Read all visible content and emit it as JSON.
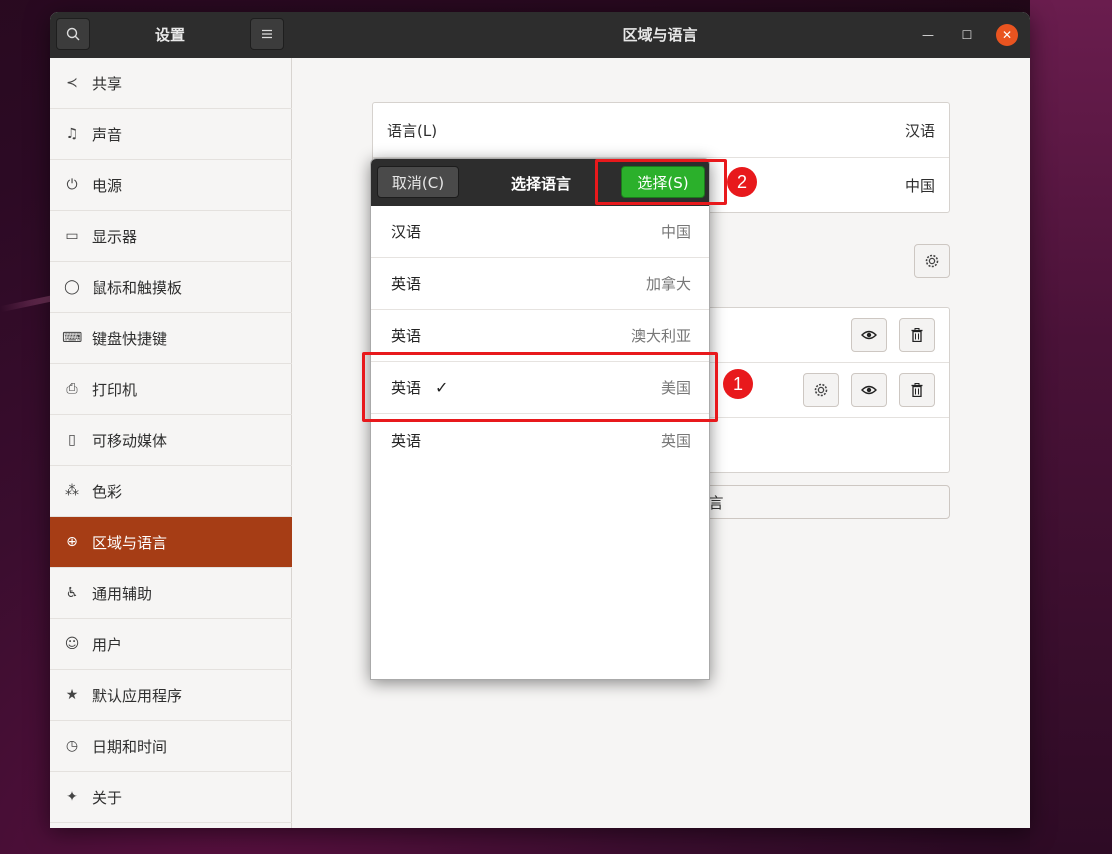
{
  "titlebar": {
    "left_title": "设置",
    "main_title": "区域与语言",
    "search_icon": "search-icon",
    "menu_icon": "hamburger-icon",
    "minimize_glyph": "—",
    "maximize_glyph": "☐",
    "close_glyph": "✕"
  },
  "sidebar": {
    "items": [
      {
        "label": "共享",
        "icon": "share-icon",
        "glyph": "≺"
      },
      {
        "label": "声音",
        "icon": "music-note-icon",
        "glyph": "♫"
      },
      {
        "label": "电源",
        "icon": "power-icon",
        "glyph": "⏻"
      },
      {
        "label": "显示器",
        "icon": "display-icon",
        "glyph": "▭"
      },
      {
        "label": "鼠标和触摸板",
        "icon": "mouse-icon",
        "glyph": "◯"
      },
      {
        "label": "键盘快捷键",
        "icon": "keyboard-icon",
        "glyph": "⌨"
      },
      {
        "label": "打印机",
        "icon": "printer-icon",
        "glyph": "⎙"
      },
      {
        "label": "可移动媒体",
        "icon": "usb-drive-icon",
        "glyph": "▯"
      },
      {
        "label": "色彩",
        "icon": "color-circles-icon",
        "glyph": "⁂"
      },
      {
        "label": "区域与语言",
        "icon": "globe-icon",
        "glyph": "⊕"
      },
      {
        "label": "通用辅助",
        "icon": "accessibility-icon",
        "glyph": "♿"
      },
      {
        "label": "用户",
        "icon": "users-icon",
        "glyph": "☺"
      },
      {
        "label": "默认应用程序",
        "icon": "star-icon",
        "glyph": "★"
      },
      {
        "label": "日期和时间",
        "icon": "clock-icon",
        "glyph": "◷"
      },
      {
        "label": "关于",
        "icon": "sparkle-icon",
        "glyph": "✦"
      }
    ],
    "active": "区域与语言"
  },
  "region": {
    "language_label": "语言(L)",
    "language_value": "汉语",
    "format_value": "中国",
    "add_button_partial": "言"
  },
  "dialog": {
    "cancel_label": "取消(C)",
    "title": "选择语言",
    "select_label": "选择(S)",
    "rows": [
      {
        "lang": "汉语",
        "region": "中国",
        "selected": false
      },
      {
        "lang": "英语",
        "region": "加拿大",
        "selected": false
      },
      {
        "lang": "英语",
        "region": "澳大利亚",
        "selected": false
      },
      {
        "lang": "英语",
        "region": "美国",
        "selected": true
      },
      {
        "lang": "英语",
        "region": "英国",
        "selected": false
      }
    ],
    "check_glyph": "✓"
  },
  "annotations": {
    "step1": "1",
    "step2": "2",
    "color": "#e8191c"
  },
  "colors": {
    "accent": "#a63d15",
    "select_green": "#2bb02b",
    "close_orange": "#e95420"
  }
}
